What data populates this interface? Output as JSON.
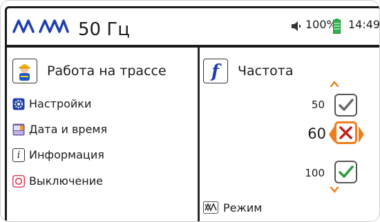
{
  "header": {
    "title": "50 Гц",
    "volume_icon": "speaker-icon",
    "battery_percent": "100%",
    "battery_level": 1.0,
    "time": "14:49"
  },
  "left_panel": {
    "title": "Работа на трассе",
    "title_icon": "worker-icon",
    "menu": [
      {
        "label": "Настройки",
        "icon": "gear-icon"
      },
      {
        "label": "Дата и время",
        "icon": "calendar-icon"
      },
      {
        "label": "Информация",
        "icon": "info-icon"
      },
      {
        "label": "Выключение",
        "icon": "power-icon"
      }
    ]
  },
  "right_panel": {
    "title": "Частота",
    "title_icon": "frequency-icon",
    "options": [
      {
        "value": "50",
        "state": "checked-gray"
      },
      {
        "value": "60",
        "state": "selected-cross"
      },
      {
        "value": "100",
        "state": "checked-green"
      }
    ],
    "footer_label": "Режим",
    "footer_icon": "mode-icon"
  },
  "colors": {
    "accent_blue": "#1e3fae",
    "accent_orange": "#f07d1a",
    "cross_red": "#c0241c",
    "check_green": "#2e9b3b",
    "battery_green": "#2bb34a",
    "border_dark": "#1b1b1b"
  }
}
